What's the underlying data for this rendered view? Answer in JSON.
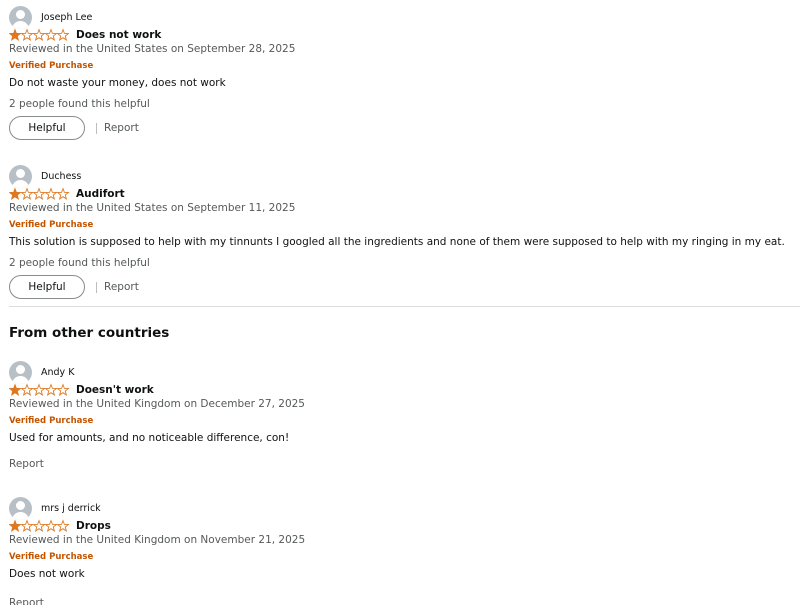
{
  "reviews_us": [
    {
      "name": "Joseph Lee",
      "rating": 1,
      "rating_max": 5,
      "title": "Does not work",
      "meta": "Reviewed in the United States on September 28, 2025",
      "verified": "Verified Purchase",
      "body": "Do not waste your money, does not work",
      "helpful_count": "2 people found this helpful",
      "helpful_label": "Helpful",
      "report_label": "Report"
    },
    {
      "name": "Duchess",
      "rating": 1,
      "rating_max": 5,
      "title": "Audifort",
      "meta": "Reviewed in the United States on September 11, 2025",
      "verified": "Verified Purchase",
      "body": "This solution is supposed to help with my tinnunts I googled all the ingredients and none of them were supposed to help with my ringing in my eat.",
      "helpful_count": "2 people found this helpful",
      "helpful_label": "Helpful",
      "report_label": "Report"
    }
  ],
  "other_countries": {
    "heading": "From other countries",
    "reviews": [
      {
        "name": "Andy K",
        "rating": 1,
        "rating_max": 5,
        "title": "Doesn't work",
        "meta": "Reviewed in the United Kingdom on December 27, 2025",
        "verified": "Verified Purchase",
        "body": "Used for amounts, and no noticeable difference, con!",
        "report_label": "Report"
      },
      {
        "name": "mrs j derrick",
        "rating": 1,
        "rating_max": 5,
        "title": "Drops",
        "meta": "Reviewed in the United Kingdom on November 21, 2025",
        "verified": "Verified Purchase",
        "body": "Does not work",
        "report_label": "Report"
      }
    ]
  },
  "colors": {
    "star_fill": "#de7921",
    "verified": "#c45500",
    "muted_text": "#565959",
    "avatar": "#b8c0c7"
  },
  "icons": {
    "avatar": "default-avatar-icon",
    "star": "star-rating-icon"
  }
}
